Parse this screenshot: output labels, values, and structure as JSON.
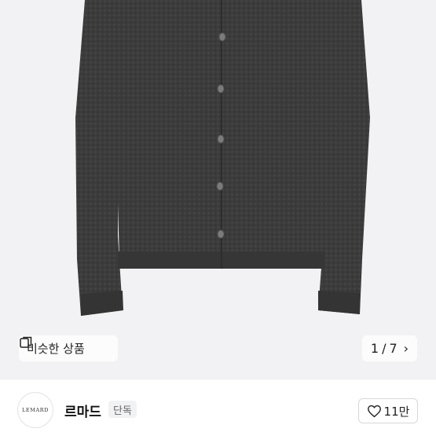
{
  "gallery": {
    "similar_label": "비슷한 상품",
    "page_current": "1",
    "page_total": "7",
    "page_separator": "/"
  },
  "shop": {
    "logo_text": "LEMARD",
    "name": "르마드",
    "badge": "단독"
  },
  "like": {
    "count": "11만"
  },
  "colors": {
    "background": "#f2f2f4",
    "product": "#3b3c3b"
  },
  "icons": [
    "similar-items-icon",
    "chevron-right-icon",
    "heart-icon"
  ]
}
